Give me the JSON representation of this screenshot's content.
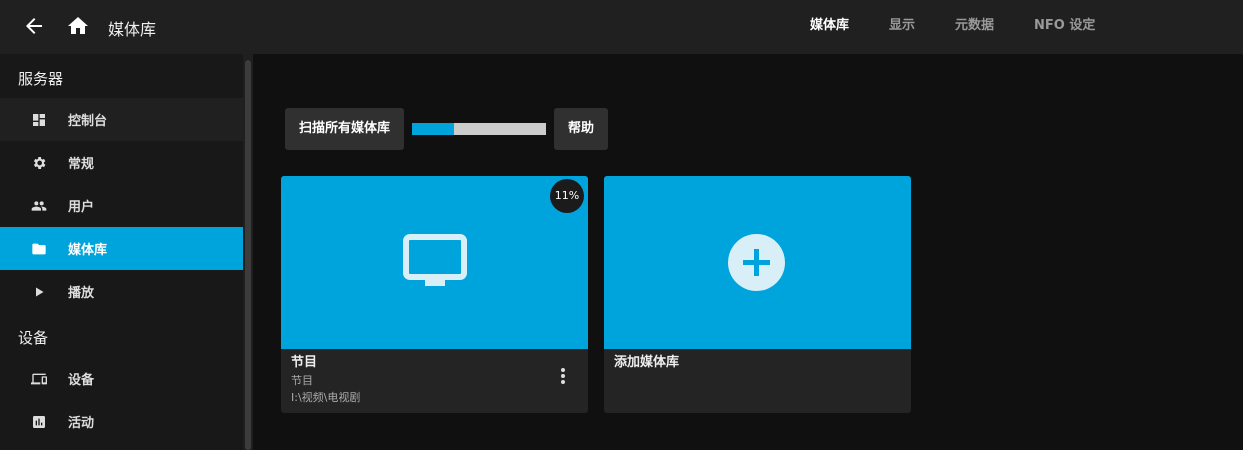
{
  "header": {
    "back_icon": "arrow-left-icon",
    "home_icon": "home-icon",
    "title": "媒体库",
    "tabs": [
      {
        "label": "媒体库",
        "active": true
      },
      {
        "label": "显示",
        "active": false
      },
      {
        "label": "元数据",
        "active": false
      },
      {
        "label": "NFO 设定",
        "active": false
      }
    ]
  },
  "sidebar": {
    "sections": [
      {
        "title": "服务器",
        "items": [
          {
            "label": "控制台",
            "icon": "dashboard-icon"
          },
          {
            "label": "常规",
            "icon": "gear-icon"
          },
          {
            "label": "用户",
            "icon": "users-icon"
          },
          {
            "label": "媒体库",
            "icon": "folder-icon",
            "active": true
          },
          {
            "label": "播放",
            "icon": "play-icon"
          }
        ]
      },
      {
        "title": "设备",
        "items": [
          {
            "label": "设备",
            "icon": "devices-icon"
          },
          {
            "label": "活动",
            "icon": "activity-icon"
          }
        ]
      }
    ]
  },
  "toolbar": {
    "scan_label": "扫描所有媒体库",
    "scan_progress_percent": 31,
    "help_label": "帮助"
  },
  "libraries": [
    {
      "title": "节目",
      "type": "节目",
      "path": "I:\\视频\\电视剧",
      "icon": "tv-icon",
      "progress": "11%"
    }
  ],
  "add_library": {
    "label": "添加媒体库",
    "icon": "plus-icon"
  },
  "colors": {
    "accent": "#00a4dc",
    "header_bg": "#202020",
    "page_bg": "#101010"
  }
}
